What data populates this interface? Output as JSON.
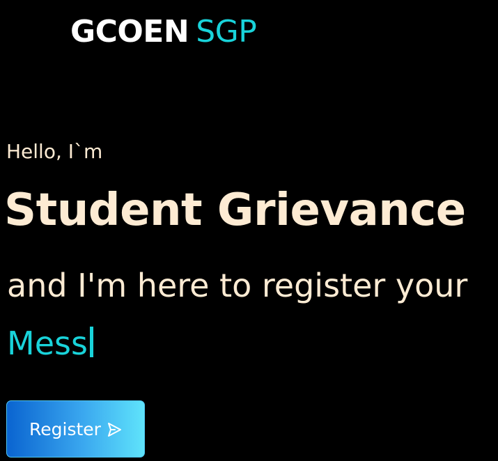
{
  "header": {
    "brand_main": "GCOEN",
    "brand_accent": "SGP"
  },
  "hero": {
    "greeting": "Hello, I`m",
    "headline": "Student Grievance",
    "subline": "and I'm here to register your",
    "typed_text": "Mess",
    "register_label": "Register",
    "register_icon": "send-icon"
  },
  "colors": {
    "background": "#000000",
    "text": "#fdebd3",
    "accent": "#19d3da",
    "button_gradient_start": "#0a64d0",
    "button_gradient_end": "#5fe3fb"
  }
}
